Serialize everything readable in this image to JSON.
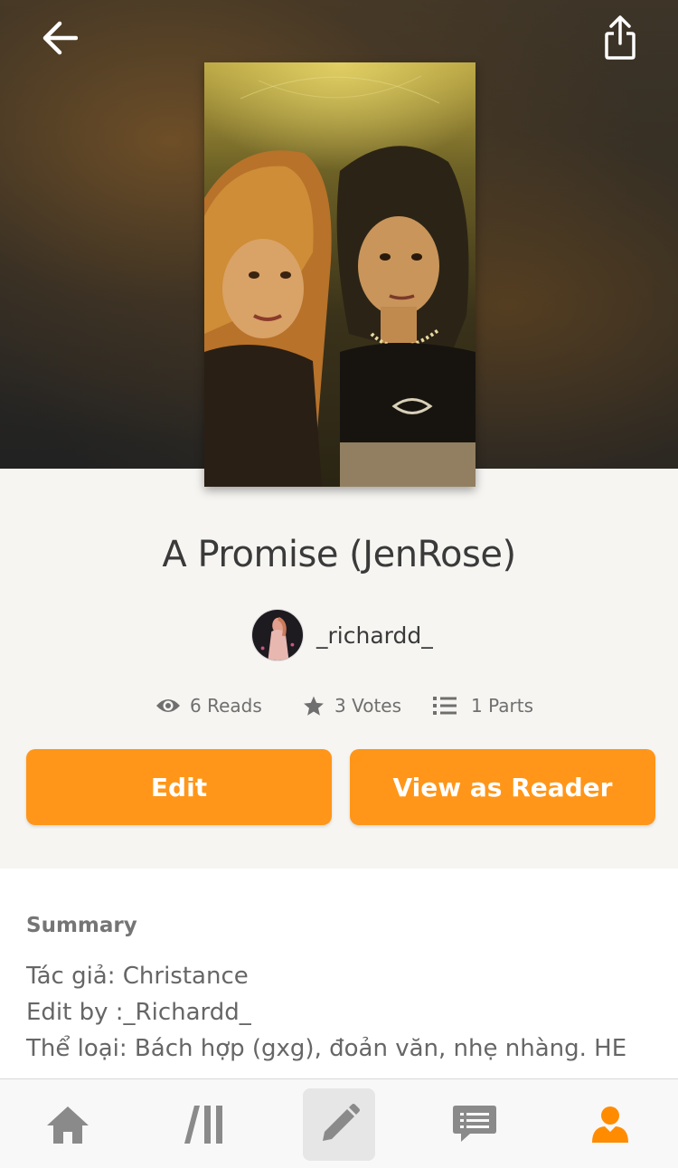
{
  "story": {
    "title": "A Promise (JenRose)",
    "author": "_richardd_"
  },
  "stats": {
    "reads": "6 Reads",
    "votes": "3 Votes",
    "parts": "1 Parts"
  },
  "actions": {
    "edit_label": "Edit",
    "view_label": "View as Reader"
  },
  "summary": {
    "label": "Summary",
    "lines": [
      "Tác giả: Christance",
      "Edit by :_Richardd_",
      "Thể loại: Bách hợp (gxg), đoản văn, nhẹ nhàng. HE"
    ]
  },
  "icons": {
    "back": "arrow-left-icon",
    "share": "share-icon",
    "reads": "eye-icon",
    "votes": "star-icon",
    "parts": "list-icon",
    "tab_home": "home-icon",
    "tab_library": "library-icon",
    "tab_write": "pencil-icon",
    "tab_messages": "chat-icon",
    "tab_profile": "person-icon"
  },
  "colors": {
    "accent": "#ff9619",
    "active_tab": "#ff8c00",
    "inactive_tab": "#8a8a8a"
  }
}
